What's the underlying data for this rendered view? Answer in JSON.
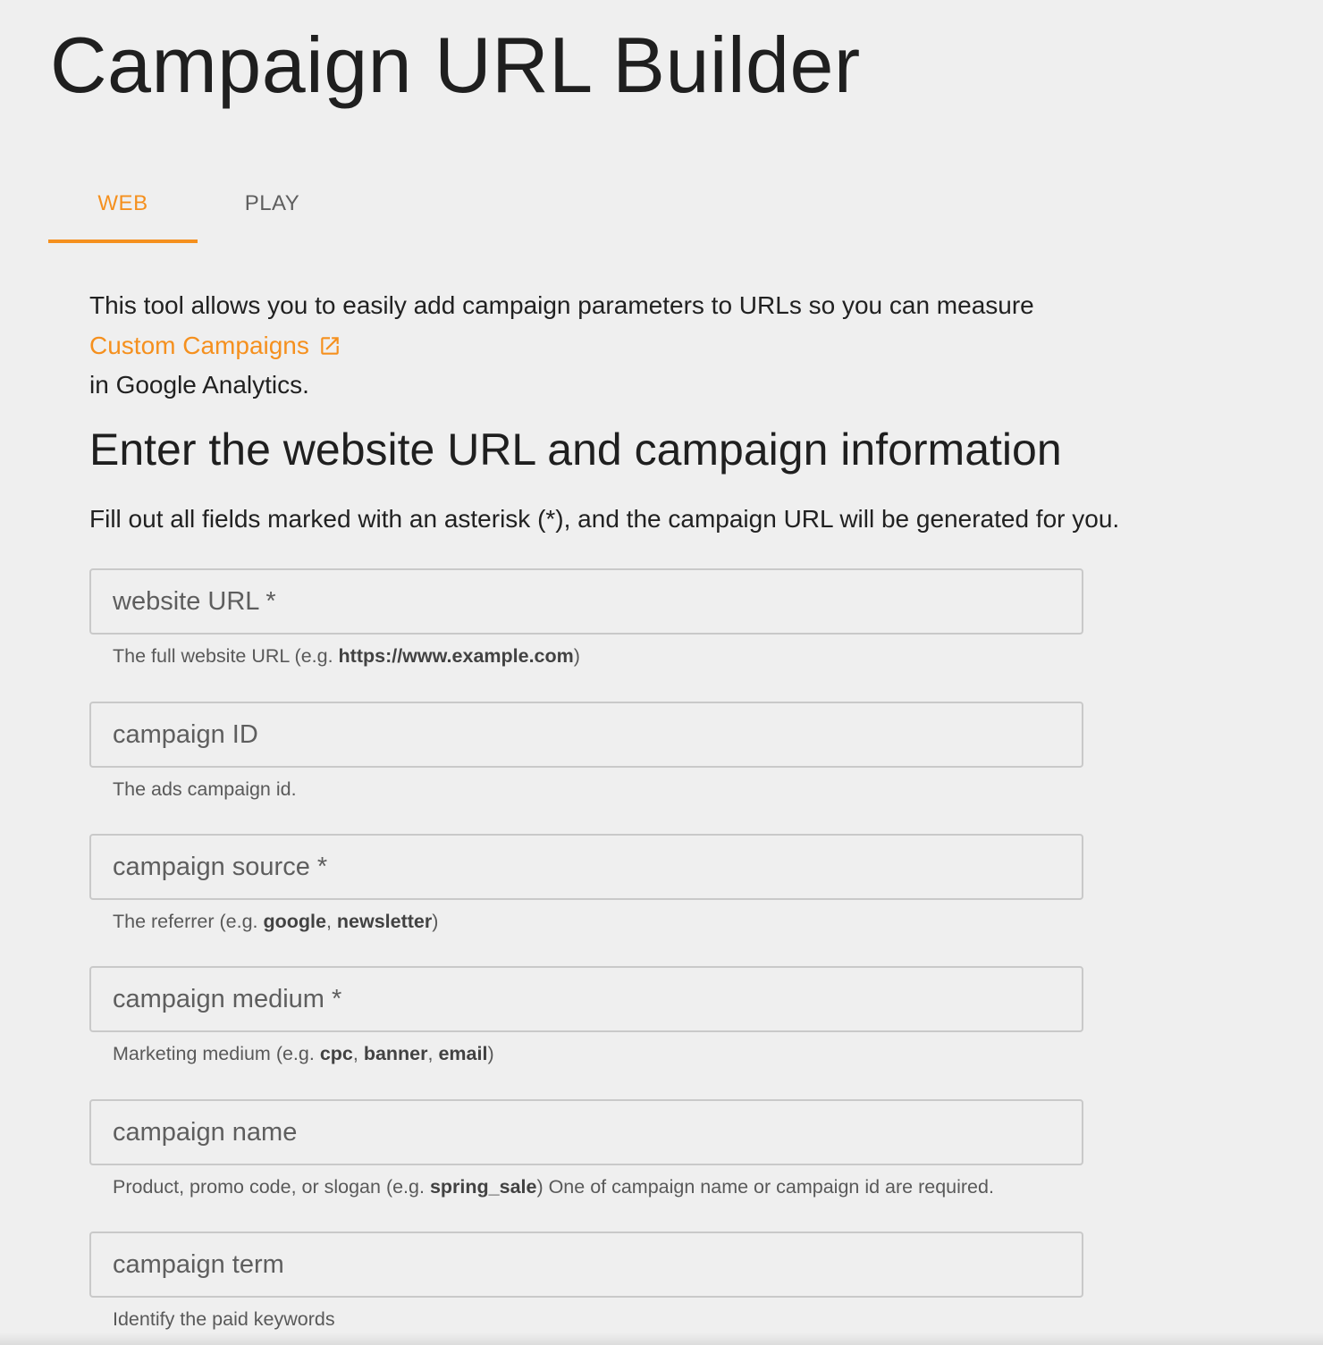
{
  "page": {
    "title": "Campaign URL Builder"
  },
  "tabs": [
    {
      "label": "WEB",
      "active": true
    },
    {
      "label": "PLAY",
      "active": false
    }
  ],
  "intro": {
    "text_before": "This tool allows you to easily add campaign parameters to URLs so you can measure",
    "link_label": "Custom Campaigns",
    "link_icon": "external-link-icon",
    "text_after": "in Google Analytics."
  },
  "section": {
    "heading": "Enter the website URL and campaign information",
    "instructions": "Fill out all fields marked with an asterisk (*), and the campaign URL will be generated for you."
  },
  "fields": [
    {
      "placeholder": "website URL *",
      "value": "",
      "helper": {
        "prefix": "The full website URL (e.g. ",
        "examples": [
          "https://www.example.com"
        ],
        "suffix": ")"
      }
    },
    {
      "placeholder": "campaign ID",
      "value": "",
      "helper": {
        "prefix": "The ads campaign id.",
        "examples": [],
        "suffix": ""
      }
    },
    {
      "placeholder": "campaign source *",
      "value": "",
      "helper": {
        "prefix": "The referrer (e.g. ",
        "examples": [
          "google",
          "newsletter"
        ],
        "suffix": ")"
      }
    },
    {
      "placeholder": "campaign medium *",
      "value": "",
      "helper": {
        "prefix": "Marketing medium (e.g. ",
        "examples": [
          "cpc",
          "banner",
          "email"
        ],
        "suffix": ")"
      }
    },
    {
      "placeholder": "campaign name",
      "value": "",
      "helper": {
        "prefix": "Product, promo code, or slogan (e.g. ",
        "examples": [
          "spring_sale"
        ],
        "suffix": ") One of campaign name or campaign id are required."
      }
    },
    {
      "placeholder": "campaign term",
      "value": "",
      "helper": {
        "prefix": "Identify the paid keywords",
        "examples": [],
        "suffix": ""
      }
    }
  ],
  "colors": {
    "accent": "#f5901e",
    "background": "#efefef",
    "field_border": "#c9c9c9"
  }
}
